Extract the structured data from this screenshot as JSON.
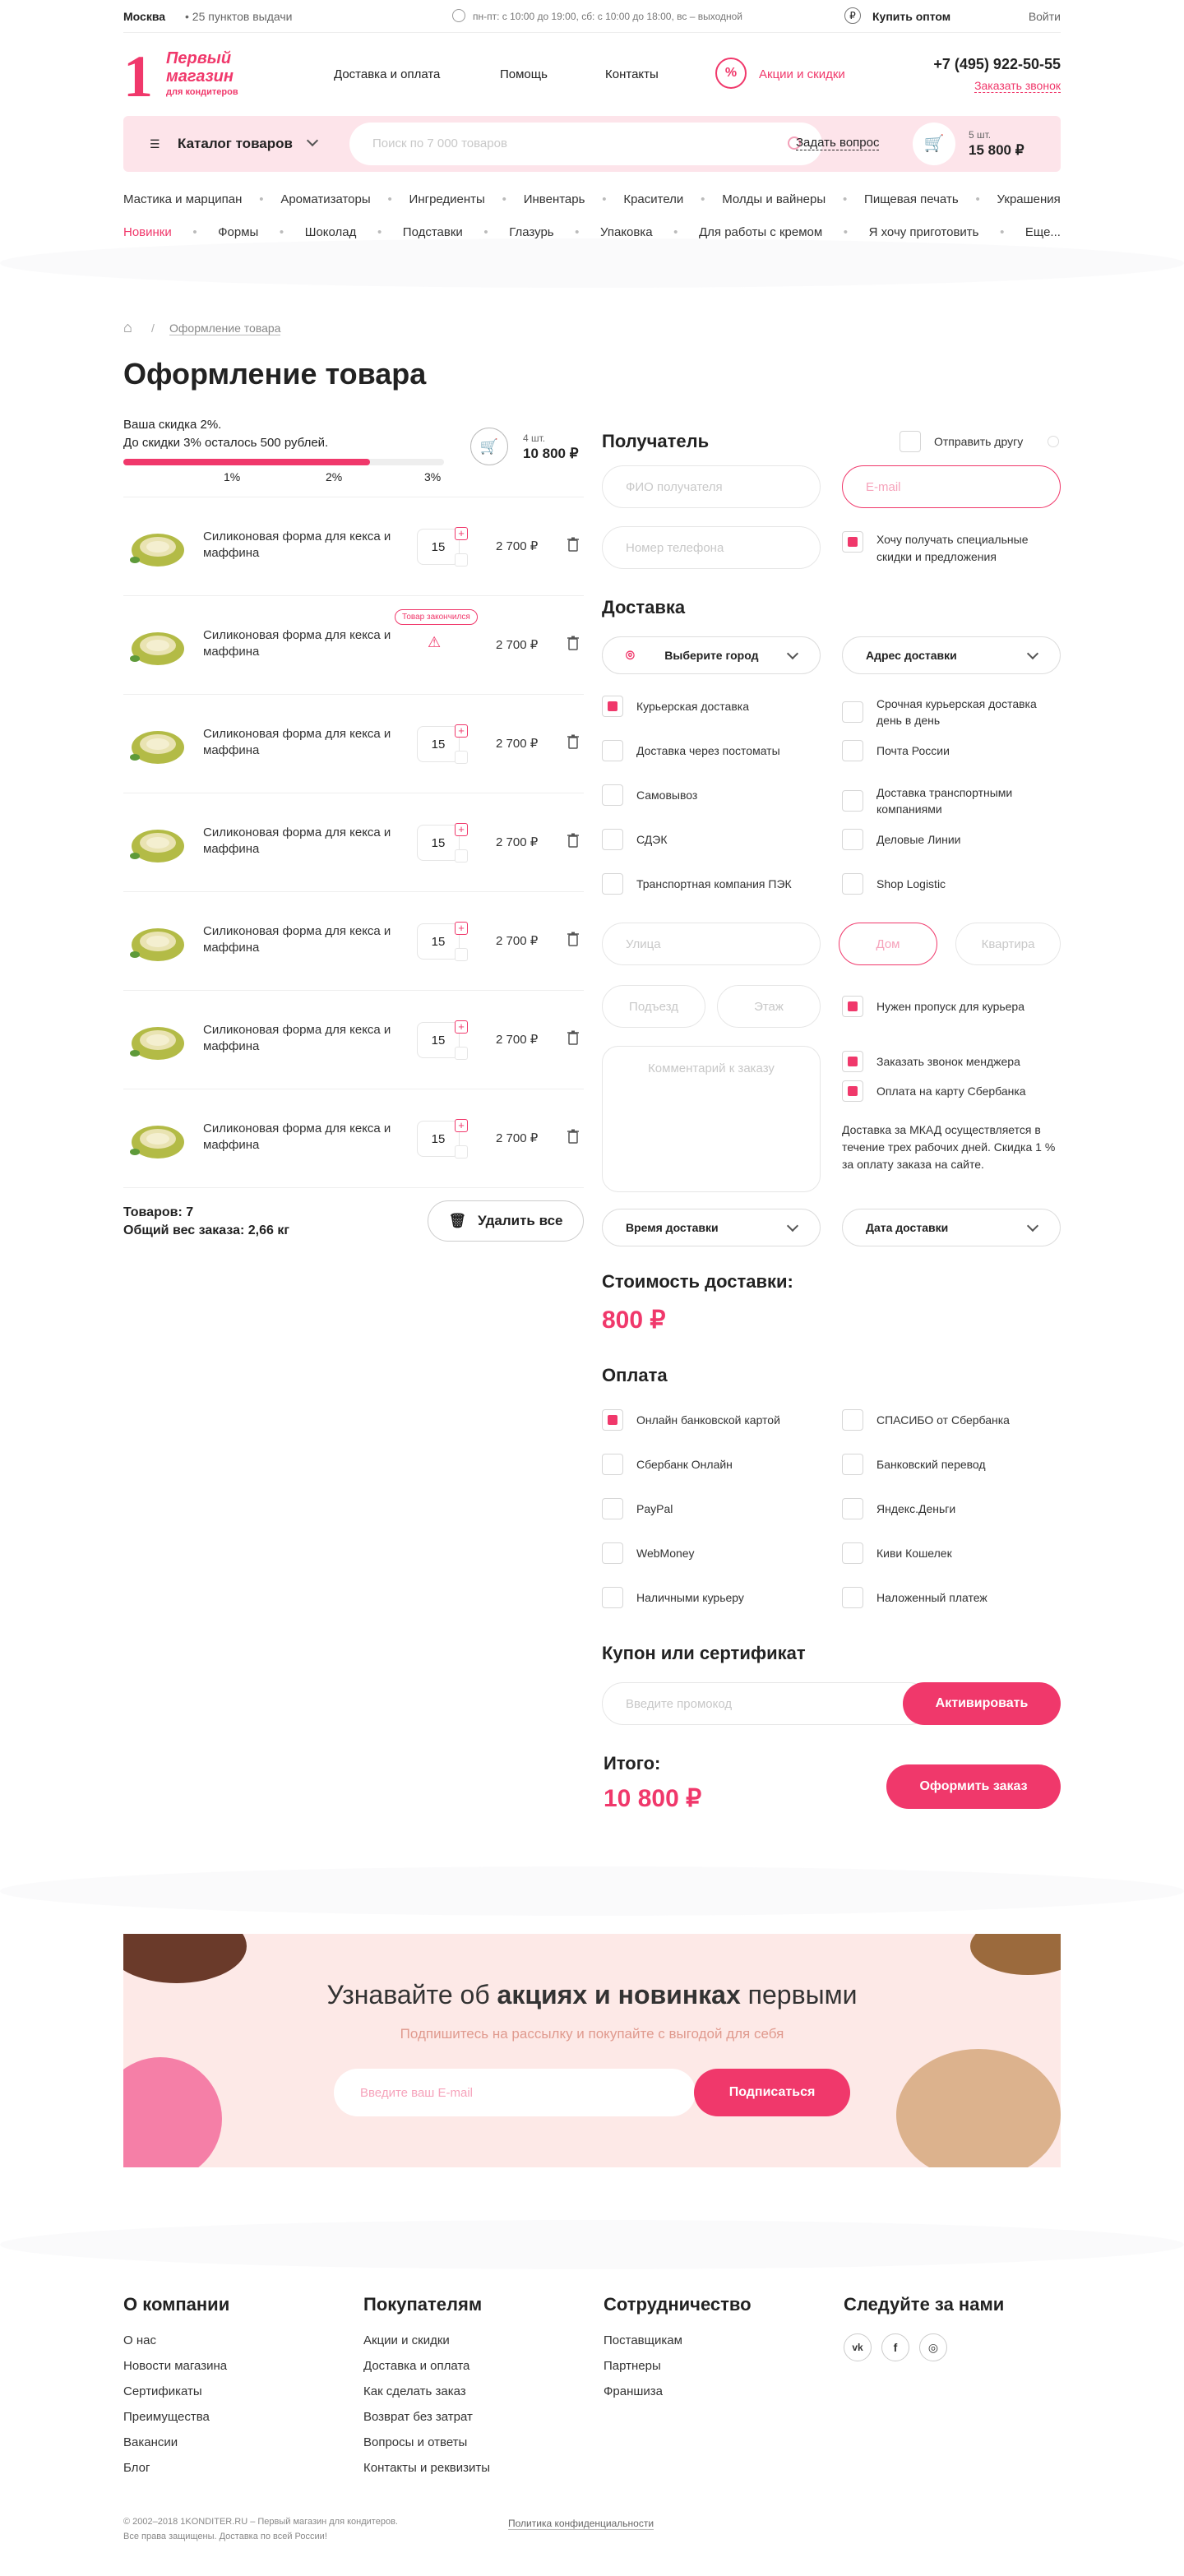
{
  "topbar": {
    "city": "Москва",
    "pickup": "25 пунктов выдачи",
    "hours": "пн-пт: с 10:00 до 19:00, сб: с 10:00 до 18:00, вс – выходной",
    "wholesale": "Купить оптом",
    "login": "Войти"
  },
  "header": {
    "logo_num": "1",
    "logo_line1": "Первый",
    "logo_line2": "магазин",
    "logo_line3": "для кондитеров",
    "nav": [
      "Доставка и оплата",
      "Помощь",
      "Контакты"
    ],
    "promo": "Акции и скидки",
    "phone": "+7 (495) 922-50-55",
    "callback": "Заказать звонок"
  },
  "searchbar": {
    "catalog": "Каталог товаров",
    "placeholder": "Поиск по 7 000 товаров",
    "ask": "Задать вопрос",
    "cart_count": "5 шт.",
    "cart_sum": "15 800 ₽"
  },
  "categories": {
    "row1": [
      "Мастика и марципан",
      "Ароматизаторы",
      "Ингредиенты",
      "Инвентарь",
      "Красители",
      "Молды и вайнеры",
      "Пищевая печать",
      "Украшения"
    ],
    "row2": [
      "Новинки",
      "Формы",
      "Шоколад",
      "Подставки",
      "Глазурь",
      "Упаковка",
      "Для работы с кремом",
      "Я хочу приготовить",
      "Еще..."
    ]
  },
  "breadcrumb": {
    "current": "Оформление товара"
  },
  "page_title": "Оформление товара",
  "discount": {
    "line1": "Ваша скидка 2%.",
    "line2": "До скидки 3% осталось 500 рублей.",
    "progress": 0.77,
    "marks": [
      "1%",
      "2%",
      "3%"
    ],
    "count": "4 шт.",
    "sum": "10 800 ₽"
  },
  "cart": {
    "items": [
      {
        "name": "Силиконовая форма для кекса и маффина",
        "qty": "15",
        "price": "2 700 ₽",
        "out": false
      },
      {
        "name": "Силиконовая форма для кекса и маффина",
        "qty": "",
        "price": "2 700 ₽",
        "out": true,
        "out_label": "Товар закончился"
      },
      {
        "name": "Силиконовая форма для кекса и маффина",
        "qty": "15",
        "price": "2 700 ₽",
        "out": false
      },
      {
        "name": "Силиконовая форма для кекса и маффина",
        "qty": "15",
        "price": "2 700 ₽",
        "out": false
      },
      {
        "name": "Силиконовая форма для кекса и маффина",
        "qty": "15",
        "price": "2 700 ₽",
        "out": false
      },
      {
        "name": "Силиконовая форма для кекса и маффина",
        "qty": "15",
        "price": "2 700 ₽",
        "out": false
      },
      {
        "name": "Силиконовая форма для кекса и маффина",
        "qty": "15",
        "price": "2 700 ₽",
        "out": false
      }
    ],
    "total_items": "Товаров: 7",
    "total_weight": "Общий вес заказа: 2,66 кг",
    "delete_all": "Удалить все"
  },
  "recipient": {
    "title": "Получатель",
    "send_friend": "Отправить другу",
    "name_ph": "ФИО получателя",
    "email_ph": "E-mail",
    "phone_ph": "Номер телефона",
    "subscribe": "Хочу получать специальные скидки и предложения"
  },
  "delivery": {
    "title": "Доставка",
    "city": "Выберите город",
    "address": "Адрес доставки",
    "options_left": [
      "Курьерская доставка",
      "Доставка через постоматы",
      "Самовывоз",
      "СДЭК",
      "Транспортная компания ПЭК"
    ],
    "options_right": [
      "Срочная курьерская доставка день в день",
      "Почта России",
      "Доставка транспортными компаниями",
      "Деловые Линии",
      "Shop Logistic"
    ],
    "street": "Улица",
    "house": "Дом",
    "flat": "Квартира",
    "entrance": "Подъезд",
    "floor": "Этаж",
    "pass": "Нужен пропуск для курьера",
    "comment": "Комментарий к заказу",
    "call_manager": "Заказать звонок менджера",
    "pay_sber": "Оплата на карту Сбербанка",
    "note": "Доставка за МКАД осуществляется в течение трех рабочих дней. Скидка 1 % за оплату заказа на сайте.",
    "time": "Время доставки",
    "date": "Дата доставки",
    "cost_title": "Стоимость доставки:",
    "cost": "800 ₽"
  },
  "payment": {
    "title": "Оплата",
    "left": [
      "Онлайн банковской картой",
      "Сбербанк Онлайн",
      "PayPal",
      "WebMoney",
      "Наличными курьеру"
    ],
    "right": [
      "СПАСИБО от Сбербанка",
      "Банковский перевод",
      "Яндекс.Деньги",
      "Киви Кошелек",
      "Наложенный платеж"
    ]
  },
  "coupon": {
    "title": "Купон или сертификат",
    "placeholder": "Введите промокод",
    "button": "Активировать"
  },
  "total": {
    "label": "Итого:",
    "sum": "10 800 ₽",
    "order": "Оформить заказ"
  },
  "newsletter": {
    "title_pre": "Узнавайте об ",
    "title_bold": "акциях и новинках",
    "title_post": " первыми",
    "subtitle": "Подпишитесь на рассылку и покупайте с выгодой для себя",
    "placeholder": "Введите ваш E-mail",
    "button": "Подписаться"
  },
  "footer": {
    "col1": {
      "title": "О компании",
      "links": [
        "О нас",
        "Новости магазина",
        "Сертификаты",
        "Преимущества",
        "Вакансии",
        "Блог"
      ]
    },
    "col2": {
      "title": "Покупателям",
      "links": [
        "Акции и скидки",
        "Доставка и оплата",
        "Как сделать заказ",
        "Возврат без затрат",
        "Вопросы и ответы",
        "Контакты и реквизиты"
      ]
    },
    "col3": {
      "title": "Сотрудничество",
      "links": [
        "Поставщикам",
        "Партнеры",
        "Франшиза"
      ]
    },
    "col4": {
      "title": "Следуйте за нами",
      "icons": [
        "vk-icon",
        "facebook-icon",
        "instagram-icon"
      ]
    },
    "copy1": "© 2002–2018 1KONDITER.RU – Первый магазин для кондитеров.",
    "copy2": "Все права защищены. Доставка по всей России!",
    "privacy": "Политика конфиденциальности"
  },
  "colors": {
    "accent": "#f0386b",
    "pink_bg": "#fde4ea"
  }
}
